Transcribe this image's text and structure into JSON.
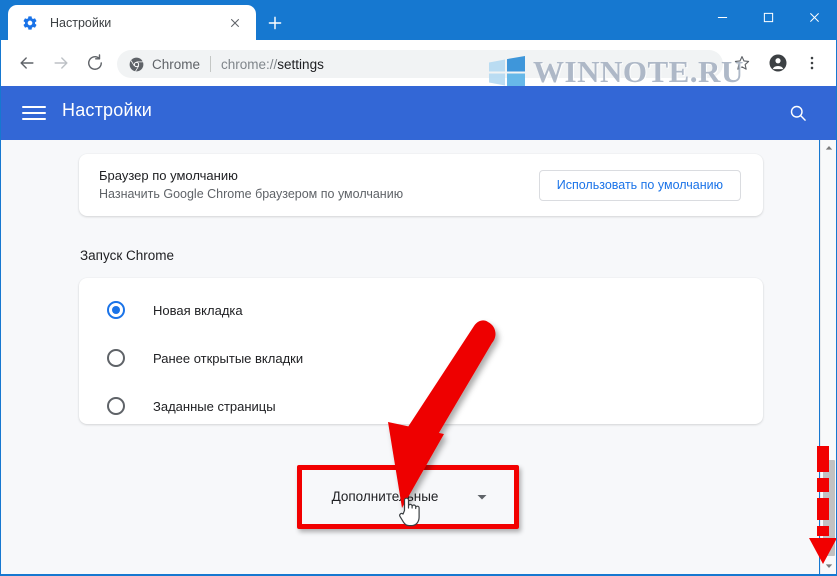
{
  "window": {
    "controls": {
      "minimize": "minimize-button",
      "maximize": "maximize-button",
      "close": "close-button"
    }
  },
  "tabstrip": {
    "tab": {
      "title": "Настройки",
      "favicon": "gear-icon",
      "close": "close-tab-icon"
    },
    "new_tab_label": "+"
  },
  "toolbar": {
    "back": "back-arrow-icon",
    "forward": "forward-arrow-icon",
    "reload": "reload-icon",
    "omnibox": {
      "site_icon": "chrome-icon",
      "site_label": "Chrome",
      "url_scheme": "chrome://",
      "url_path": "settings"
    },
    "bookmark": "star-icon",
    "profile": "account-avatar-icon",
    "menu": "three-dot-menu-icon"
  },
  "watermark": {
    "text": "WINNOTE.RU",
    "logo": "windows-logo-icon"
  },
  "settings_header": {
    "menu_icon": "hamburger-icon",
    "title": "Настройки",
    "search_icon": "search-icon"
  },
  "content": {
    "default_browser": {
      "title": "Браузер по умолчанию",
      "subtitle": "Назначить Google Chrome браузером по умолчанию",
      "button_label": "Использовать по умолчанию"
    },
    "startup": {
      "heading": "Запуск Chrome",
      "options": [
        {
          "label": "Новая вкладка",
          "selected": true
        },
        {
          "label": "Ранее открытые вкладки",
          "selected": false
        },
        {
          "label": "Заданные страницы",
          "selected": false
        }
      ]
    },
    "advanced": {
      "label": "Дополнительные",
      "chevron": "chevron-down-icon"
    }
  },
  "annotations": {
    "highlight_color": "#f20000",
    "arrow_color": "#ee0000",
    "cursor": "hand-pointer-cursor"
  },
  "scrollbar": {
    "up_arrow": "scroll-up-icon",
    "down_arrow": "scroll-down-icon",
    "thumb": "scroll-thumb"
  },
  "colors": {
    "titlebar_blue": "#1678d0",
    "settings_header_blue": "#3367d6",
    "accent_blue": "#1a73e8",
    "content_bg": "#f7f8fa"
  }
}
